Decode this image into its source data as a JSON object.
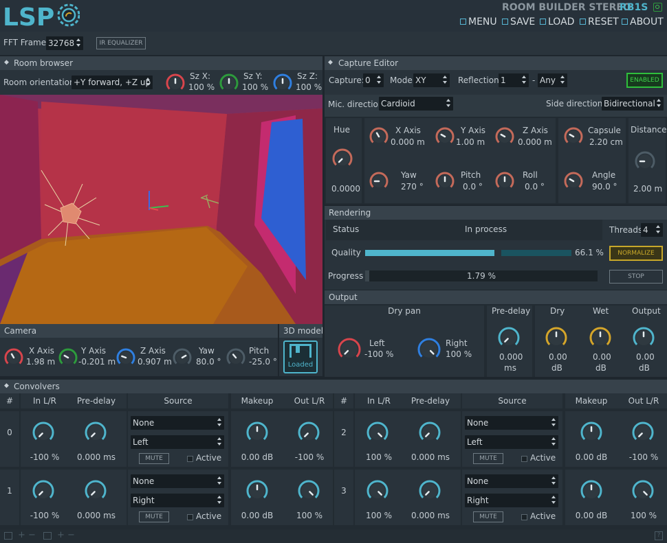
{
  "header": {
    "title": "ROOM BUILDER STEREO",
    "code": "RB1S",
    "menu": [
      "MENU",
      "SAVE",
      "LOAD",
      "RESET",
      "ABOUT"
    ]
  },
  "fft": {
    "label": "FFT Frame",
    "value": "32768",
    "ir_button": "IR EQUALIZER"
  },
  "room_browser": {
    "title": "Room browser",
    "orientation_label": "Room orientation:",
    "orientation_value": "+Y forward, +Z up",
    "sz": [
      {
        "label": "Sz X:",
        "value": "100 %"
      },
      {
        "label": "Sz Y:",
        "value": "100 %"
      },
      {
        "label": "Sz Z:",
        "value": "100 %"
      }
    ]
  },
  "camera": {
    "title": "Camera",
    "knobs": [
      {
        "label": "X Axis",
        "value": "1.98 m"
      },
      {
        "label": "Y Axis",
        "value": "-0.201 m"
      },
      {
        "label": "Z Axis",
        "value": "0.907 m"
      },
      {
        "label": "Yaw",
        "value": "80.0 °"
      },
      {
        "label": "Pitch",
        "value": "-25.0 °"
      }
    ]
  },
  "model": {
    "title": "3D model",
    "status": "Loaded"
  },
  "capture": {
    "title": "Capture Editor",
    "capture_label": "Capture:",
    "capture_value": "0",
    "mode_label": "Mode",
    "mode_value": "XY",
    "refl_label": "Reflections",
    "refl_value": "1",
    "dash": "-",
    "refl_any": "Any",
    "enabled": "ENABLED",
    "mic_label": "Mic. direction",
    "mic_value": "Cardioid",
    "side_label": "Side direction",
    "side_value": "Bidirectional",
    "hue_label": "Hue",
    "hue_value": "0.0000",
    "axes": [
      {
        "label": "X Axis",
        "value": "0.000 m"
      },
      {
        "label": "Y Axis",
        "value": "1.00 m"
      },
      {
        "label": "Z Axis",
        "value": "0.000 m"
      }
    ],
    "rot": [
      {
        "label": "Yaw",
        "value": "270 °"
      },
      {
        "label": "Pitch",
        "value": "0.0 °"
      },
      {
        "label": "Roll",
        "value": "0.0 °"
      }
    ],
    "capsule": {
      "label": "Capsule",
      "value": "2.20 cm"
    },
    "angle": {
      "label": "Angle",
      "value": "90.0 °"
    },
    "distance": {
      "label": "Distance",
      "value": "2.00 m"
    }
  },
  "rendering": {
    "title": "Rendering",
    "status_label": "Status",
    "status_value": "In process",
    "quality_label": "Quality",
    "quality_value": "66.1 %",
    "quality_fraction": 0.661,
    "progress_label": "Progress",
    "progress_value": "1.79 %",
    "progress_fraction": 0.0179,
    "threads_label": "Threads",
    "threads_value": "4",
    "normalize": "NORMALIZE",
    "stop": "STOP"
  },
  "output": {
    "title": "Output",
    "drypan": "Dry pan",
    "left_label": "Left",
    "left_value": "-100 %",
    "right_label": "Right",
    "right_value": "100 %",
    "predelay": {
      "label": "Pre-delay",
      "value": "0.000",
      "unit": "ms"
    },
    "levels": [
      {
        "label": "Dry",
        "value": "0.00",
        "unit": "dB"
      },
      {
        "label": "Wet",
        "value": "0.00",
        "unit": "dB"
      },
      {
        "label": "Output",
        "value": "0.00",
        "unit": "dB"
      }
    ]
  },
  "convolvers": {
    "title": "Convolvers",
    "headers": [
      "#",
      "In L/R",
      "Pre-delay",
      "Source",
      "Makeup",
      "Out L/R"
    ],
    "mute": "MUTE",
    "active": "Active",
    "rows": [
      {
        "n": "0",
        "inlr": "-100 %",
        "pre": "0.000 ms",
        "src1": "None",
        "src2": "Left",
        "makeup": "0.00 dB",
        "out": "-100 %"
      },
      {
        "n": "1",
        "inlr": "-100 %",
        "pre": "0.000 ms",
        "src1": "None",
        "src2": "Right",
        "makeup": "0.00 dB",
        "out": "100 %"
      },
      {
        "n": "2",
        "inlr": "100 %",
        "pre": "0.000 ms",
        "src1": "None",
        "src2": "Left",
        "makeup": "0.00 dB",
        "out": "-100 %"
      },
      {
        "n": "3",
        "inlr": "100 %",
        "pre": "0.000 ms",
        "src1": "None",
        "src2": "Right",
        "makeup": "0.00 dB",
        "out": "100 %"
      }
    ]
  },
  "colors": {
    "accent": "#4fb5cc",
    "red": "#d8454c",
    "green": "#2d9a3c",
    "blue": "#2f7fe0",
    "gold": "#d4a52a",
    "hue": "#c46a5a",
    "bg": "#1e262d"
  }
}
